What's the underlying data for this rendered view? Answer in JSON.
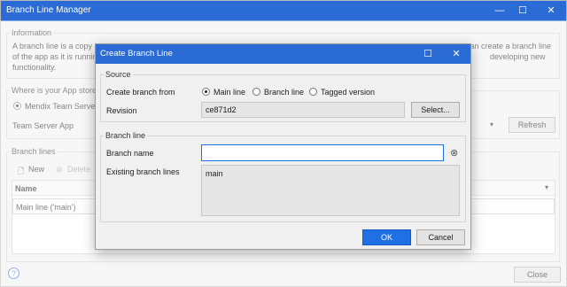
{
  "main_window": {
    "title": "Branch Line Manager",
    "controls": {
      "minimize": "—",
      "maximize": "☐",
      "close": "✕"
    },
    "information": {
      "legend": "Information",
      "line1_left": "A branch line is a copy o",
      "line1_right": "can create a branch line",
      "line2_left": "of the app as it is runnin",
      "line2_right": "developing new",
      "line3": "functionality."
    },
    "app_store": {
      "legend": "Where is your App store",
      "radio_label": "Mendix Team Server",
      "server_label": "Team Server App",
      "refresh_label": "Refresh"
    },
    "branch_lines": {
      "legend": "Branch lines",
      "new_label": "New",
      "delete_label": "Delete",
      "column_name": "Name",
      "row_value": "Main line ('main')"
    },
    "help_icon": "?",
    "close_label": "Close"
  },
  "dialog": {
    "title": "Create Branch Line",
    "controls": {
      "maximize": "☐",
      "close": "✕"
    },
    "source": {
      "legend": "Source",
      "create_from_label": "Create branch from",
      "options": [
        "Main line",
        "Branch line",
        "Tagged version"
      ],
      "selected": "Main line",
      "revision_label": "Revision",
      "revision_value": "ce871d2",
      "select_label": "Select..."
    },
    "branch_line": {
      "legend": "Branch line",
      "name_label": "Branch name",
      "name_value": "",
      "existing_label": "Existing branch lines",
      "existing_items": [
        "main"
      ]
    },
    "ok_label": "OK",
    "cancel_label": "Cancel"
  },
  "colors": {
    "accent": "#2b6bd6",
    "primary_button": "#1f6fe5",
    "background": "#f0f0f0"
  },
  "icons": {
    "new": "new-file-icon",
    "delete": "delete-icon",
    "clear": "clear-icon",
    "help": "help-icon",
    "dropdown": "chevron-down-icon"
  }
}
